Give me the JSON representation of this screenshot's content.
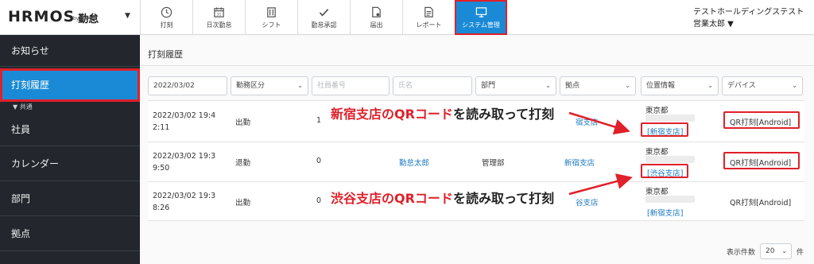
{
  "header": {
    "logo": "HRMOS",
    "logo_kintai": "勤怠",
    "logo_by": "by IEYASU",
    "company": "テストホールディングステスト",
    "user": "営業太郎 ▼",
    "nav": [
      {
        "label": "打刻",
        "icon": "clock-icon"
      },
      {
        "label": "日次勤怠",
        "icon": "calendar-icon"
      },
      {
        "label": "シフト",
        "icon": "shift-icon"
      },
      {
        "label": "勤怠承認",
        "icon": "check-icon"
      },
      {
        "label": "届出",
        "icon": "document-stamp-icon"
      },
      {
        "label": "レポート",
        "icon": "report-icon"
      },
      {
        "label": "システム管理",
        "icon": "monitor-icon"
      }
    ],
    "active_color": "#1a8ad6",
    "highlight_color": "#e0202a"
  },
  "sidebar": {
    "items": [
      {
        "label": "お知らせ"
      },
      {
        "label": "打刻履歴"
      },
      {
        "label": "社員"
      },
      {
        "label": "カレンダー"
      },
      {
        "label": "部門"
      },
      {
        "label": "拠点"
      }
    ],
    "group_label": "▼ 共通"
  },
  "main": {
    "title": "打刻履歴",
    "filters": {
      "date": "2022/03/02",
      "kubun": "勤務区分",
      "employee_no_placeholder": "社員番号",
      "name_placeholder": "氏名",
      "department": "部門",
      "location": "拠点",
      "position_info": "位置情報",
      "device": "デバイス"
    },
    "rows": [
      {
        "datetime": "2022/03/02 19:42:11",
        "dt1": "2022/03/02 19:4",
        "dt2": "2:11",
        "kubun": "出勤",
        "emp_no": "1",
        "name": "",
        "dept": "",
        "location": "宿支店",
        "pos_city": "東京都",
        "pos_branch": "[新宿支店]",
        "device": "QR打刻[Android]"
      },
      {
        "datetime": "2022/03/02 19:39:50",
        "dt1": "2022/03/02 19:3",
        "dt2": "9:50",
        "kubun": "退勤",
        "emp_no": "0",
        "name": "勤怠太郎",
        "dept": "管理部",
        "location": "新宿支店",
        "pos_city": "東京都",
        "pos_branch": "[渋谷支店]",
        "device": "QR打刻[Android]"
      },
      {
        "datetime": "2022/03/02 19:38:26",
        "dt1": "2022/03/02 19:3",
        "dt2": "8:26",
        "kubun": "出勤",
        "emp_no": "0",
        "name": "",
        "dept": "",
        "location": "谷支店",
        "pos_city": "東京都",
        "pos_branch": "[新宿支店]",
        "device": "QR打刻[Android]"
      }
    ],
    "annotations": [
      {
        "hl": "新宿支店のQRコード",
        "rest": "を読み取って打刻"
      },
      {
        "hl": "渋谷支店のQRコード",
        "rest": "を読み取って打刻"
      }
    ],
    "pager": {
      "label": "表示件数",
      "value": "20",
      "unit": "件"
    }
  }
}
